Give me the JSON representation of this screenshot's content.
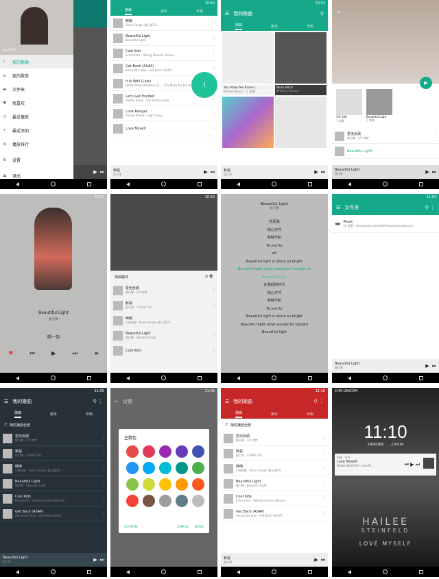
{
  "p1": {
    "time": "10:48",
    "items": [
      "我的歌曲",
      "我的歌单",
      "文件夹",
      "我喜欢",
      "最近播放",
      "最近添加",
      "播放排行",
      "设置",
      "退出"
    ],
    "header_name": "Jay Cho...",
    "header_user": "",
    "mini_artist": ""
  },
  "p2": {
    "time": "10:50",
    "tabs": [
      "歌曲",
      "歌手",
      "专辑"
    ],
    "songs": [
      [
        "時雨",
        "Piano Songs~路上第2号"
      ],
      [
        "Beautiful Light",
        "Beautiful Light"
      ],
      [
        "Cool Kids",
        "Echosmith · Talking Dreams (Delux..."
      ],
      [
        "Get Back (ASAP)",
        "Alexandra Stan · Get Back (ASAP)"
      ],
      [
        "It Is Well (Live)",
        "Bethel Music/Kristene Di... · You Make Me Brave (Live)"
      ],
      [
        "Let's Get Excited",
        "Alesha Dixon · The Alesha show"
      ],
      [
        "Lone Ranger",
        "Rachel Platten · Fight Song"
      ],
      [
        "Love Myself",
        ""
      ]
    ],
    "fab": "I",
    "mini_title": "秋桜",
    "mini_artist": "坂口澪"
  },
  "p3": {
    "time": "10:53",
    "title": "我的歌曲",
    "tabs": [
      "歌曲",
      "歌手",
      "专辑"
    ],
    "albums": [
      [
        "You Make Me Brave (...",
        "Bethel Music · 1 首歌"
      ],
      [
        "Work Bitch",
        "Britney Spears"
      ],
      [
        "",
        ""
      ],
      [
        "",
        ""
      ]
    ],
    "mini_title": "秋桜",
    "mini_artist": "坂口澪"
  },
  "p4": {
    "albums": [
      [
        "1/2 的梦",
        "1 首歌"
      ],
      [
        "Beautiful Light",
        "1 首歌"
      ]
    ],
    "songs": [
      [
        "爱无反顾",
        "姚贝娜 · 1/2 的梦"
      ],
      [
        "Beautiful Light",
        ""
      ]
    ],
    "mini_title": "Beautiful Light",
    "mini_artist": "姚贝娜"
  },
  "p5": {
    "time": "10:57",
    "title": "Beautiful Light",
    "artist": "姚贝娜",
    "lyric": "唱一到"
  },
  "p6": {
    "time": "10:59",
    "queue_title": "单曲循环",
    "songs": [
      [
        "爱无反顾",
        "姚贝娜 · 1/2 的梦"
      ],
      [
        "秋桜",
        "坂口澪 · COVER 70s"
      ],
      [
        "時雨",
        "小林未郁 · Piano Songs~路上第2号"
      ],
      [
        "Beautiful Light",
        "姚贝娜 · Beautiful Light"
      ],
      [
        "Cool Kids",
        ""
      ]
    ]
  },
  "p7": {
    "title": "Beautiful Light",
    "artist": "姚贝娜",
    "lyrics": [
      "然而我",
      "积心灯芹",
      "和种节犯",
      "To me fly",
      "oh",
      "Beautiful light is shine so bright",
      "Beautiful light what wonderful tonight oh",
      "Beautiful light",
      "在我经的时代",
      "积心灯芹",
      "和种节犯",
      "To me fly",
      "Beautiful light is shine so bright",
      "Beautiful light what wonderful tonight",
      "Beautiful light"
    ],
    "active": 6
  },
  "p8": {
    "time": "11:03",
    "title": "文件夹",
    "folder": "Music",
    "path": "12 首歌 · /storage/emulated/0/netease/cloudmusic/...",
    "mini_title": "Beautiful Light",
    "mini_artist": "姚贝娜"
  },
  "p9": {
    "time": "11:05",
    "title": "我的歌曲",
    "tabs": [
      "歌曲",
      "歌手",
      "专辑"
    ],
    "shuffle": "随机播放全部",
    "songs": [
      [
        "爱无反顾",
        "姚贝娜 · 1/2 的梦"
      ],
      [
        "秋桜",
        "坂口澪 · COVER 70s"
      ],
      [
        "時雨",
        "小林未郁 · Piano Songs~路上第2号"
      ],
      [
        "Beautiful Light",
        "姚贝娜 · Beautiful Light"
      ],
      [
        "Cool Kids",
        "Echosmith · Talking Dreams (Deluxe..."
      ],
      [
        "Get Back (ASAP)",
        "Alexandra Stan · Get Back (ASAP)"
      ]
    ],
    "mini_title": "Beautiful Light",
    "mini_artist": "姚贝娜"
  },
  "p10": {
    "time": "11:06",
    "title": "设置",
    "sub1": "外观",
    "sub2": "主题色",
    "dialog_title": "主题色",
    "custom": "CUSTOM",
    "cancel": "CANCEL",
    "done": "DONE",
    "colors": [
      "#e54a4a",
      "#e03b5b",
      "#9c27b0",
      "#673ab7",
      "#3f51b5",
      "#2196f3",
      "#03a9f4",
      "#00bcd4",
      "#009688",
      "#4caf50",
      "#8bc34a",
      "#cddc39",
      "#ffc107",
      "#ff9800",
      "#ff5722",
      "#f44336",
      "#795548",
      "#9e9e9e",
      "#607d8b",
      "#bdbdbd"
    ]
  },
  "p11": {
    "time": "11:16",
    "title": "我的歌曲",
    "tabs": [
      "歌曲",
      "歌手",
      "专辑"
    ],
    "shuffle": "随机播放全部",
    "songs": [
      [
        "爱无反顾",
        "姚贝娜 · 1/2 的梦"
      ],
      [
        "秋桜",
        "坂口澪 · COVER 70s"
      ],
      [
        "時雨",
        "小林未郁 · Piano Songs~路上第2号"
      ],
      [
        "Beautiful Light",
        "姚贝娜 · Beautiful Light"
      ],
      [
        "Cool Kids",
        "Echosmith · Talking Dreams (Deluxe..."
      ],
      [
        "Get Back (ASAP)",
        "Alexandra Stan · Get Back (ASAP)"
      ]
    ],
    "mini_title": "秋桜",
    "mini_artist": "坂口澪"
  },
  "p12": {
    "carrier": "CHN-UNICOM",
    "clock": "11:10",
    "date": "2月9日周四 · ... 上午9:00",
    "notif_app": "新歌 · 现在",
    "notif_title": "Love Myself",
    "notif_sub": "Hailee Steinfeld - Love M...",
    "art1": "HAILEE",
    "art2": "STEINFELD",
    "art3": "LOVE MYSELF"
  }
}
